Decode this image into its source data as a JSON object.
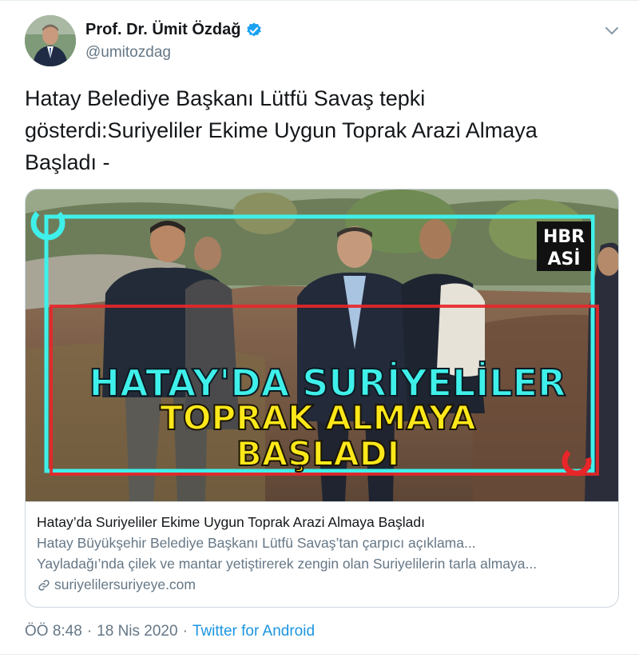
{
  "tweet": {
    "author": {
      "display_name": "Prof. Dr. Ümit Özdağ",
      "handle": "@umitozdag",
      "verified": true
    },
    "text_lines": [
      "Hatay Belediye Başkanı Lütfü Savaş tepki",
      "gösterdi:Suriyeliler Ekime Uygun Toprak Arazi Almaya",
      "Başladı -"
    ],
    "card": {
      "image_overlay": {
        "line1": "HATAY'DA SURİYELİLER",
        "line2": "TOPRAK ALMAYA",
        "line3": "BAŞLADI",
        "logo_top": "HBR",
        "logo_bottom": "ASİ"
      },
      "title": "Hatay’da Suriyeliler Ekime Uygun Toprak Arazi Almaya Başladı",
      "description_line1": "Hatay Büyükşehir Belediye Başkanı Lütfü Savaş’tan çarpıcı açıklama...",
      "description_line2": "Yayladağı’nda çilek ve mantar yetiştirerek zengin olan Suriyelilerin tarla almaya...",
      "domain": "suriyelilersuriyeye.com"
    },
    "meta": {
      "time": "ÖÖ 8:48",
      "separator": "·",
      "date": "18 Nis 2020",
      "source": "Twitter for Android"
    }
  },
  "colors": {
    "text_primary": "#14171a",
    "text_secondary": "#657786",
    "link": "#1b95e0",
    "verified": "#1da1f2",
    "overlay_cyan": "#3ff0ea",
    "overlay_yellow": "#ffe81a",
    "frame_red": "#e8262a"
  },
  "icons": {
    "verified": "verified-badge-icon",
    "caret": "chevron-down-icon",
    "link": "link-icon"
  }
}
